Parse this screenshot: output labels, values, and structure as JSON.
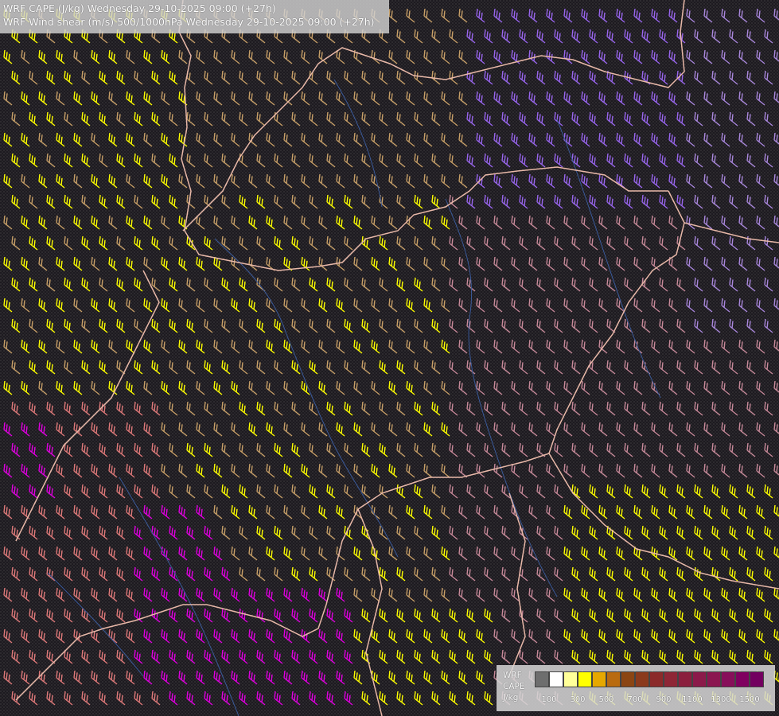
{
  "header": {
    "line1": "WRF CAPE (J/kg) Wednesday 29-10-2025 09:00 (+27h)",
    "line2": "WRF Wind shear (m/s) 500/1000hPa Wednesday 29-10-2025 09:00 (+27h)"
  },
  "legend": {
    "label_line1": "WRF",
    "label_line2": "CAPE",
    "label_line3": "J/kg",
    "swatch_colors": [
      "#6e6e6e",
      "#ffffff",
      "#ffff99",
      "#ffff00",
      "#e6a800",
      "#b96b0f",
      "#8b4513",
      "#8b3a1c",
      "#8b2a2a",
      "#8e2636",
      "#8b1f3e",
      "#8b1a4a",
      "#8b1550",
      "#870f5a",
      "#800060",
      "#730060"
    ],
    "ticks": [
      "100",
      "300",
      "500",
      "700",
      "900",
      "1100",
      "1300",
      "1500"
    ]
  },
  "map": {
    "background": "#1d1a20",
    "border_color": "#e8b8a8",
    "river_color": "#3a5a9a",
    "barb_colors": {
      "yellow": "#ffff00",
      "tan": "#c8a068",
      "salmon": "#e07a7a",
      "magenta": "#e000e0",
      "purple": "#9966ee",
      "lavender": "#aa88dd",
      "pink": "#c88a9a"
    }
  }
}
